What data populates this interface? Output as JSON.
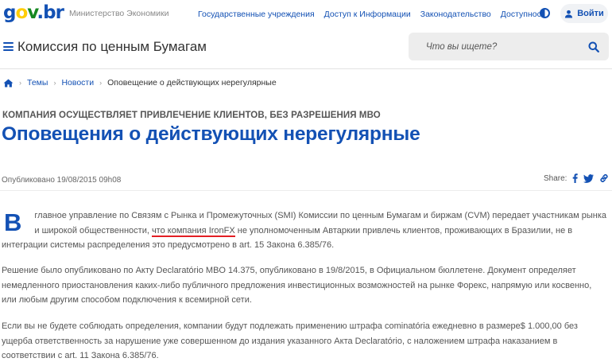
{
  "brand": {
    "logo": {
      "g": "g",
      "o": "o",
      "v": "v",
      "dot": ".",
      "b": "b",
      "r": "r"
    },
    "ministry": "Министерство Экономики",
    "colors": {
      "primary": "#1351b4",
      "accent_yellow": "#ffcd07",
      "accent_green": "#168821",
      "underline": "#e31e24"
    }
  },
  "topnav": {
    "links": [
      "Государственные учреждения",
      "Доступ к Информации",
      "Законодательство",
      "Доступность"
    ],
    "login_label": "Войти",
    "contrast_icon": "contrast-icon",
    "user_icon": "user-icon"
  },
  "header": {
    "title": "Комиссия по ценным Бумагам",
    "search_placeholder": "Что вы ищете?"
  },
  "breadcrumb": {
    "home_icon": "home-icon",
    "items": [
      "Темы",
      "Новости"
    ],
    "current": "Оповещение о действующих нерегулярные"
  },
  "article": {
    "kicker": "КОМПАНИЯ ОСУЩЕСТВЛЯЕТ ПРИВЛЕЧЕНИЕ КЛИЕНТОВ, БЕЗ РАЗРЕШЕНИЯ МВО",
    "title": "Оповещения о действующих нерегулярные",
    "published": "Опубликовано 19/08/2015 09h08",
    "share_label": "Share:",
    "p1": {
      "dropcap": "В",
      "before": "главное управление по Связям с Рынка и Промежуточных (SMI) Комиссии по ценным Бумагам и биржам (CVM) передает участникам рынка и широкой общественности, ",
      "highlight": "что компания IronFX",
      "after": " не уполномоченным Автаркии привлечь клиентов, проживающих в Бразилии, не в интеграции системы распределения это предусмотрено в art. 15 Закона 6.385/76."
    },
    "p2": "Решение было опубликовано по Акту Declaratório MBO 14.375, опубликовано в 19/8/2015, в Официальном бюллетене. Документ определяет немедленного приостановления каких-либо публичного предложения инвестиционных возможностей на рынке Форекс, напрямую или косвенно, или любым другим способом подключения к всемирной сети.",
    "p3": "Если вы не будете соблюдать определения, компании будут подлежать применению штрафа cominatória ежедневно в размере$ 1.000,00 без ущерба ответственность за нарушение уже совершенном до издания указанного Акта Declaratório, с наложением штрафа наказанием в соответствии с art. 11 Закона 6.385/76."
  }
}
